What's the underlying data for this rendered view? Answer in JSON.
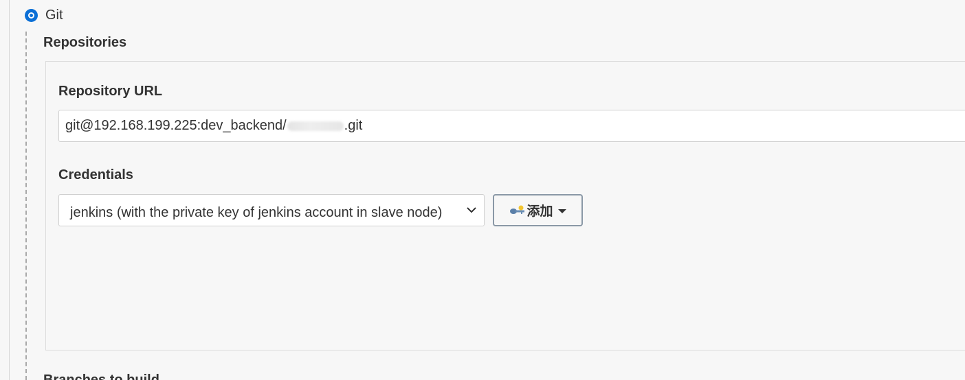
{
  "scm": {
    "option_label": "Git"
  },
  "repositories": {
    "title": "Repositories",
    "url_label": "Repository URL",
    "url_prefix": "git@192.168.199.225:dev_backend/",
    "url_suffix": ".git",
    "credentials_label": "Credentials",
    "credentials_selected": "jenkins (with the private key of jenkins account in slave node)",
    "add_button_label": "添加"
  },
  "next_section": {
    "title": "Branches to build"
  },
  "icons": {
    "radio": "radio-selected-icon",
    "select": "chevron-down-icon",
    "add": "key-icon",
    "add_caret": "caret-down-icon"
  },
  "colors": {
    "accent": "#0b6fd6",
    "button_border": "#8a98a6"
  }
}
